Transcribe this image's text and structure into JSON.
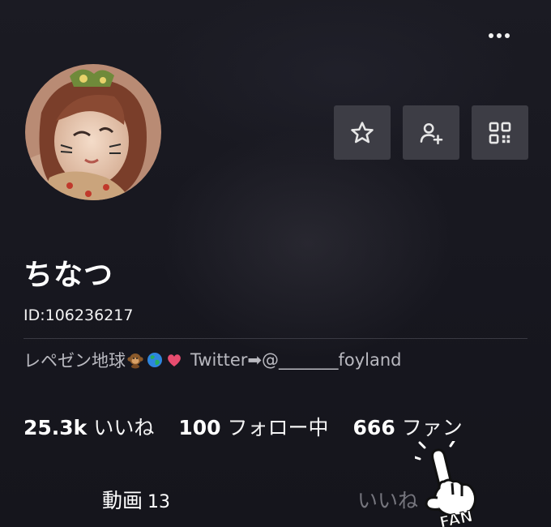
{
  "header": {
    "more_icon": "more-horizontal-icon"
  },
  "profile": {
    "name": "ちなつ",
    "id_text": "ID:106236217",
    "bio_prefix": "レペゼン地球",
    "bio_emojis": [
      "monkey-emoji",
      "globe-emoji",
      "heart-emoji"
    ],
    "bio_suffix": "Twitter➡@_______foyland"
  },
  "actions": [
    {
      "name": "favorite",
      "icon": "star-icon"
    },
    {
      "name": "follow",
      "icon": "add-user-icon"
    },
    {
      "name": "qr-code",
      "icon": "qr-code-icon"
    }
  ],
  "stats": {
    "likes": {
      "value": "25.3k",
      "label": "いいね"
    },
    "following": {
      "value": "100",
      "label": "フォロー中"
    },
    "fans": {
      "value": "666",
      "label": "ファン"
    }
  },
  "tabs": {
    "videos": {
      "label": "動画",
      "count": "13"
    },
    "likes": {
      "label": "いいね"
    }
  },
  "overlay": {
    "fan_sticker_text": "FAN"
  },
  "colors": {
    "background": "#17171f",
    "button_bg": "#3d3d45",
    "muted_text": "#b9b9c0",
    "inactive_tab": "#75757d"
  }
}
